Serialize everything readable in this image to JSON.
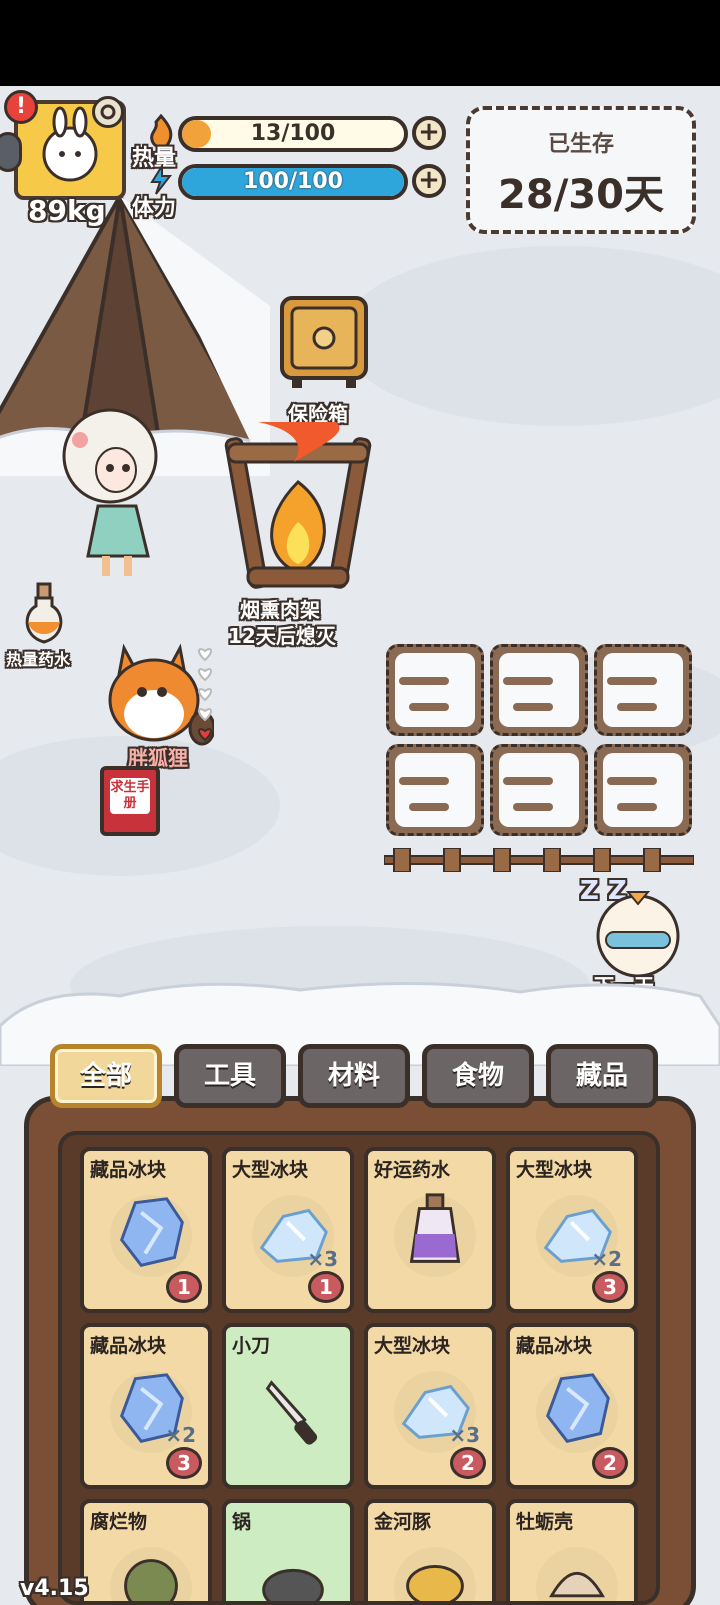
{
  "hud": {
    "weight": "89kg",
    "heat_label": "热量",
    "heat_value": "13/100",
    "heat_fraction": 0.13,
    "stamina_label": "体力",
    "stamina_value": "100/100",
    "stamina_fraction": 1.0,
    "plus": "+",
    "alert": "!"
  },
  "survive": {
    "title": "已生存",
    "days": "28/30天"
  },
  "world": {
    "safe_label": "保险箱",
    "campfire_label": "烟熏肉架",
    "campfire_status": "12天后熄灭",
    "potion_label": "热量药水",
    "fox_label": "胖狐狸",
    "manual_label": "求生手册",
    "next_day_label": "下一天",
    "zzz": "Z Z"
  },
  "tabs": [
    {
      "label": "全部",
      "active": true
    },
    {
      "label": "工具",
      "active": false
    },
    {
      "label": "材料",
      "active": false
    },
    {
      "label": "食物",
      "active": false
    },
    {
      "label": "藏品",
      "active": false
    }
  ],
  "items": [
    {
      "name": "藏品冰块",
      "count": "",
      "badge": "1",
      "icon": "crystal-ice-icon",
      "green": false
    },
    {
      "name": "大型冰块",
      "count": "×3",
      "badge": "1",
      "icon": "large-ice-icon",
      "green": false
    },
    {
      "name": "好运药水",
      "count": "",
      "badge": "",
      "icon": "luck-potion-icon",
      "green": false
    },
    {
      "name": "大型冰块",
      "count": "×2",
      "badge": "3",
      "icon": "large-ice-icon",
      "green": false
    },
    {
      "name": "藏品冰块",
      "count": "×2",
      "badge": "3",
      "icon": "crystal-ice-icon",
      "green": false
    },
    {
      "name": "小刀",
      "count": "",
      "badge": "",
      "icon": "knife-icon",
      "green": true
    },
    {
      "name": "大型冰块",
      "count": "×3",
      "badge": "2",
      "icon": "large-ice-icon",
      "green": false
    },
    {
      "name": "藏品冰块",
      "count": "",
      "badge": "2",
      "icon": "crystal-ice-icon",
      "green": false
    },
    {
      "name": "腐烂物",
      "count": "",
      "badge": "",
      "icon": "rot-icon",
      "green": false
    },
    {
      "name": "锅",
      "count": "",
      "badge": "",
      "icon": "pot-icon",
      "green": true
    },
    {
      "name": "金河豚",
      "count": "",
      "badge": "",
      "icon": "gold-fish-icon",
      "green": false
    },
    {
      "name": "牡蛎壳",
      "count": "",
      "badge": "",
      "icon": "oyster-shell-icon",
      "green": false
    }
  ],
  "version": "v4.15",
  "colors": {
    "heat": "#f2a23a",
    "stamina": "#2ea6dc",
    "wood": "#7a4f35",
    "card": "#f3d9a6",
    "card_green": "#cdecc1"
  }
}
